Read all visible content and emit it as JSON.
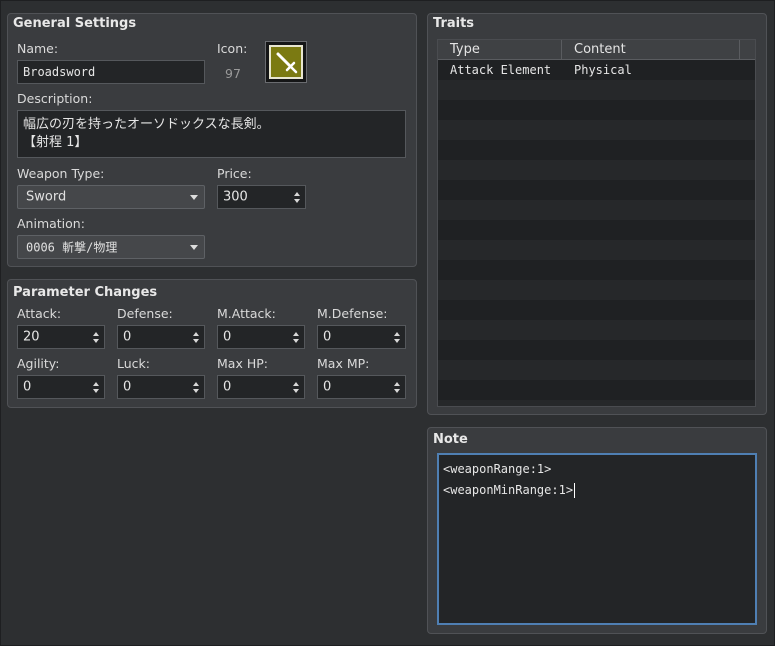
{
  "general": {
    "title": "General Settings",
    "name_label": "Name:",
    "name_value": "Broadsword",
    "icon_label": "Icon:",
    "icon_index": "97",
    "icon_name": "sword-icon",
    "description_label": "Description:",
    "description_line1": "幅広の刃を持ったオーソドックスな長剣。",
    "description_line2": "【射程 1】",
    "weapon_type_label": "Weapon Type:",
    "weapon_type_value": "Sword",
    "price_label": "Price:",
    "price_value": "300",
    "animation_label": "Animation:",
    "animation_value": "0006 斬撃/物理"
  },
  "params": {
    "title": "Parameter Changes",
    "attack_label": "Attack:",
    "attack_value": "20",
    "defense_label": "Defense:",
    "defense_value": "0",
    "mattack_label": "M.Attack:",
    "mattack_value": "0",
    "mdefense_label": "M.Defense:",
    "mdefense_value": "0",
    "agility_label": "Agility:",
    "agility_value": "0",
    "luck_label": "Luck:",
    "luck_value": "0",
    "maxhp_label": "Max HP:",
    "maxhp_value": "0",
    "maxmp_label": "Max MP:",
    "maxmp_value": "0"
  },
  "traits": {
    "title": "Traits",
    "col_type": "Type",
    "col_content": "Content",
    "rows": [
      {
        "type": "Attack Element",
        "content": "Physical"
      }
    ]
  },
  "note": {
    "title": "Note",
    "line1": "<weaponRange:1>",
    "line2": "<weaponMinRange:1>"
  },
  "colors": {
    "icon_bg": "#7b7a12",
    "focus_border": "#4f7fb3"
  }
}
